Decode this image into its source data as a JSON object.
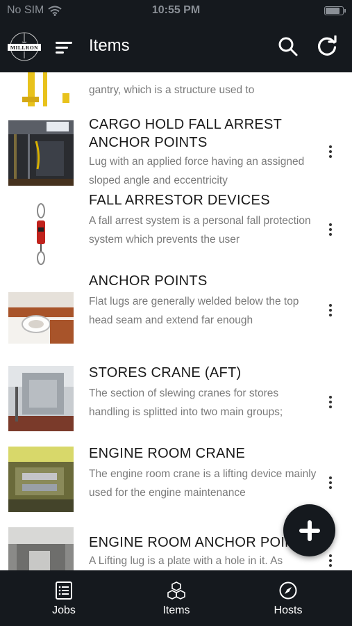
{
  "status_bar": {
    "carrier": "No SIM",
    "time": "10:55 PM",
    "battery_level": 0.85
  },
  "app_bar": {
    "logo_text": "MILLRON",
    "title": "Items"
  },
  "items": [
    {
      "title": "",
      "description": "gantry, which is a structure used to"
    },
    {
      "title": "CARGO HOLD FALL ARREST ANCHOR POINTS",
      "description": "Lug with an applied force having an assigned sloped angle and eccentricity"
    },
    {
      "title": "FALL ARRESTOR DEVICES",
      "description": "A fall arrest system is a personal fall protection system which prevents the user"
    },
    {
      "title": "ANCHOR POINTS",
      "description": "Flat lugs are generally welded below the top head seam and extend far enough"
    },
    {
      "title": "STORES CRANE (AFT)",
      "description": "The section of slewing cranes for stores handling is splitted into two main groups;"
    },
    {
      "title": "ENGINE ROOM CRANE",
      "description": "The engine room crane is a lifting device mainly used for the engine maintenance"
    },
    {
      "title": "ENGINE ROOM ANCHOR POINTS",
      "description": "A Lifting lug is a plate with a hole in it. As"
    }
  ],
  "tabs": [
    {
      "label": "Jobs",
      "icon": "list-icon"
    },
    {
      "label": "Items",
      "icon": "cubes-icon"
    },
    {
      "label": "Hosts",
      "icon": "compass-icon"
    }
  ],
  "colors": {
    "bar_background": "#15191e",
    "text_primary": "#1a1a1a",
    "text_secondary": "#7a7a7a"
  }
}
